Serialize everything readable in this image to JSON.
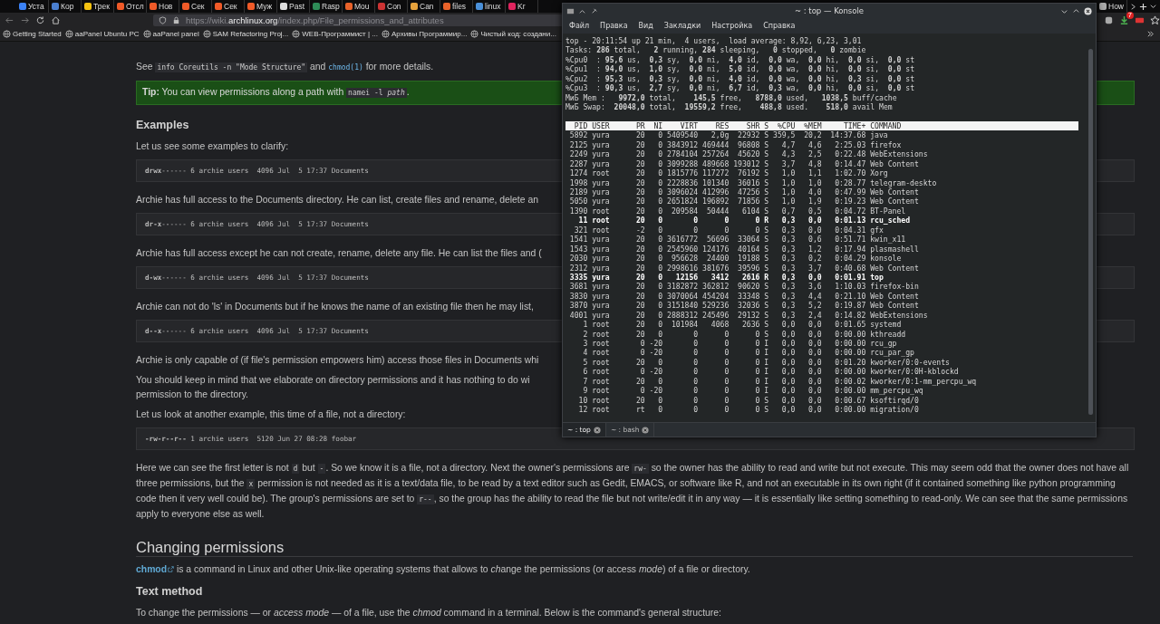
{
  "browser": {
    "tabs": [
      {
        "label": "Уста",
        "color": "#3b82f6",
        "selected": false
      },
      {
        "label": "Кор",
        "color": "#4a7fd0",
        "selected": false
      },
      {
        "label": "Трек",
        "color": "#f5c211",
        "selected": false
      },
      {
        "label": "Отсл",
        "color": "#f05a28",
        "selected": false
      },
      {
        "label": "Нов",
        "color": "#f05a28",
        "selected": false
      },
      {
        "label": "Сек",
        "color": "#f05a28",
        "selected": false
      },
      {
        "label": "Сек",
        "color": "#f05a28",
        "selected": false
      },
      {
        "label": "Муж",
        "color": "#f05a28",
        "selected": false
      },
      {
        "label": "Past",
        "color": "#dddddd",
        "selected": false
      },
      {
        "label": "Rasp",
        "color": "#2e8b57",
        "selected": false
      },
      {
        "label": "Mou",
        "color": "#e8622a",
        "selected": false
      },
      {
        "label": "Con",
        "color": "#cc3333",
        "selected": false
      },
      {
        "label": "Can",
        "color": "#e6a23c",
        "selected": false
      },
      {
        "label": "files",
        "color": "#e8622a",
        "selected": false
      },
      {
        "label": "linux",
        "color": "#4a90d9",
        "selected": false
      },
      {
        "label": "Kr",
        "color": "#e0245e",
        "selected": false
      }
    ],
    "right_tabs": [
      {
        "label": "How",
        "color": "#aaaaaa",
        "selected": false
      }
    ],
    "url": {
      "prefix": "https://wiki.",
      "domain": "archlinux.org",
      "path": "/index.php/File_permissions_and_attributes"
    },
    "download_badge": "7",
    "bookmarks": [
      "Getting Started",
      "aaPanel Ubuntu PC",
      "aaPanel panel",
      "SAM Refactoring Proj...",
      "WEB-Программист | ...",
      "Архивы Программир...",
      "Чистый код: создани..."
    ]
  },
  "article": {
    "blocks": [
      {
        "kind": "paragraph",
        "parts": [
          {
            "kind": "text",
            "text": "See "
          },
          {
            "kind": "code",
            "text": "info Coreutils -n \"Mode Structure\""
          },
          {
            "kind": "text",
            "text": " and "
          },
          {
            "kind": "codelink",
            "text": "chmod(1)"
          },
          {
            "kind": "text",
            "text": " for more details."
          }
        ]
      },
      {
        "kind": "tip",
        "parts": [
          {
            "kind": "text",
            "text": "**Tip:** You can view permissions along a path with "
          },
          {
            "kind": "code",
            "text": "namei -l *path*"
          },
          {
            "kind": "text",
            "text": "."
          }
        ]
      },
      {
        "kind": "heading",
        "text": "Examples"
      },
      {
        "kind": "paragraph",
        "parts": [
          {
            "kind": "text",
            "text": "Let us see some examples to clarify:"
          }
        ]
      },
      {
        "kind": "codeblock",
        "text": "**drwx**------ 6 archie users  4096 Jul  5 17:37 Documents"
      },
      {
        "kind": "paragraph",
        "parts": [
          {
            "kind": "text",
            "text": "Archie has full access to the Documents directory. He can list, create files and rename, delete an"
          }
        ]
      },
      {
        "kind": "codeblock",
        "text": "**dr-x**------ 6 archie users  4096 Jul  5 17:37 Documents"
      },
      {
        "kind": "paragraph",
        "parts": [
          {
            "kind": "text",
            "text": "Archie has full access except he can not create, rename, delete any file. He can list the files and ("
          }
        ]
      },
      {
        "kind": "codeblock",
        "text": "**d-wx**------ 6 archie users  4096 Jul  5 17:37 Documents"
      },
      {
        "kind": "paragraph",
        "parts": [
          {
            "kind": "text",
            "text": "Archie can not do 'ls' in Documents but if he knows the name of an existing file then he may list,"
          }
        ]
      },
      {
        "kind": "codeblock",
        "text": "**d--x**------ 6 archie users  4096 Jul  5 17:37 Documents"
      },
      {
        "kind": "paragraph",
        "parts": [
          {
            "kind": "text",
            "text": "Archie is only capable of (if file's permission empowers him) access those files in Documents whi"
          }
        ]
      },
      {
        "kind": "lines",
        "lines": [
          "You should keep in mind that we elaborate on directory permissions and it has nothing to do wi",
          "permission to the directory."
        ]
      },
      {
        "kind": "paragraph",
        "parts": [
          {
            "kind": "text",
            "text": "Let us look at another example, this time of a file, not a directory:"
          }
        ]
      },
      {
        "kind": "codeblock",
        "text": "**-rw-r--r--** 1 archie users  5120 Jun 27 08:28 foobar"
      },
      {
        "kind": "paragraph",
        "parts": [
          {
            "kind": "text",
            "text": "Here we can see the first letter is not "
          },
          {
            "kind": "code",
            "text": "d"
          },
          {
            "kind": "text",
            "text": " but "
          },
          {
            "kind": "code",
            "text": "-"
          },
          {
            "kind": "text",
            "text": ". So we know it is a file, not a directory. Next the owner's permissions are "
          },
          {
            "kind": "code",
            "text": "rw-"
          },
          {
            "kind": "text",
            "text": " so the owner has the ability to read and write but not execute. This may seem odd that the owner does not have all three permissions, but the "
          },
          {
            "kind": "code",
            "text": "x"
          },
          {
            "kind": "text",
            "text": " permission is not needed as it is a text/data file, to be read by a text editor such as Gedit, EMACS, or software like R, and not an executable in its own right (if it contained something like python programming code then it very well could be). The group's permissions are set to "
          },
          {
            "kind": "code",
            "text": "r--"
          },
          {
            "kind": "text",
            "text": ", so the group has the ability to read the file but not write/edit it in any way — it is essentially like setting something to read-only. We can see that the same permissions apply to everyone else as well."
          }
        ]
      },
      {
        "kind": "section",
        "text": "Changing permissions"
      },
      {
        "kind": "paragraph",
        "parts": [
          {
            "kind": "link",
            "text": "chmod"
          },
          {
            "kind": "text",
            "text": " is a command in Linux and other Unix-like operating systems that allows to "
          },
          {
            "kind": "italic",
            "text": "ch"
          },
          {
            "kind": "text",
            "text": "ange the permissions (or access "
          },
          {
            "kind": "italic",
            "text": "mode"
          },
          {
            "kind": "text",
            "text": ") of a file or directory."
          }
        ]
      },
      {
        "kind": "heading",
        "text": "Text method"
      },
      {
        "kind": "paragraph",
        "parts": [
          {
            "kind": "text",
            "text": "To change the permissions — or *access mode* — of a file, use the *chmod* command in a terminal. Below is the command's general structure:"
          }
        ]
      }
    ]
  },
  "konsole": {
    "title": "~ : top — Konsole",
    "menu": [
      "Файл",
      "Правка",
      "Вид",
      "Закладки",
      "Настройка",
      "Справка"
    ],
    "summary": [
      "top - 20:11:54 up 21 min,  4 users,  load average: 8,92, 6,23, 3,01",
      "Tasks: **286** total,   **2** running, **284** sleeping,   **0** stopped,   **0** zombie",
      "%Cpu0  : **95,6** us,  **0,3** sy,  **0,0** ni,  **4,0** id,  **0,0** wa,  **0,0** hi,  **0,0** si,  **0,0** st",
      "%Cpu1  : **94,0** us,  **1,0** sy,  **0,0** ni,  **5,0** id,  **0,0** wa,  **0,0** hi,  **0,0** si,  **0,0** st",
      "%Cpu2  : **95,3** us,  **0,3** sy,  **0,0** ni,  **4,0** id,  **0,0** wa,  **0,0** hi,  **0,3** si,  **0,0** st",
      "%Cpu3  : **90,3** us,  **2,7** sy,  **0,0** ni,  **6,7** id,  **0,3** wa,  **0,0** hi,  **0,0** si,  **0,0** st",
      "МиБ Mem :   **9972,0** total,    **145,5** free,   **8788,0** used,   **1038,5** buff/cache",
      "МиБ Swap:  **20048,0** total,  **19559,2** free,    **488,8** used.    **518,0** avail Mem"
    ],
    "columns": [
      "PID",
      "USER",
      "PR",
      "NI",
      "VIRT",
      "RES",
      "SHR",
      "S",
      "%CPU",
      "%MEM",
      "TIME+",
      "COMMAND"
    ],
    "rows": [
      {
        "cells": [
          "5892",
          "yura",
          "20",
          "0",
          "5409540",
          "2,0g",
          "22932",
          "S",
          "359,5",
          "20,2",
          "14:37.68",
          "java"
        ],
        "bold": false
      },
      {
        "cells": [
          "2125",
          "yura",
          "20",
          "0",
          "3843912",
          "469444",
          "96808",
          "S",
          "4,7",
          "4,6",
          "2:25.03",
          "firefox"
        ],
        "bold": false
      },
      {
        "cells": [
          "2249",
          "yura",
          "20",
          "0",
          "2784104",
          "257264",
          "45620",
          "S",
          "4,3",
          "2,5",
          "0:22.48",
          "WebExtensions"
        ],
        "bold": false
      },
      {
        "cells": [
          "2287",
          "yura",
          "20",
          "0",
          "3099288",
          "489668",
          "193012",
          "S",
          "3,7",
          "4,8",
          "0:14.47",
          "Web Content"
        ],
        "bold": false
      },
      {
        "cells": [
          "1274",
          "root",
          "20",
          "0",
          "1815776",
          "117272",
          "76192",
          "S",
          "1,0",
          "1,1",
          "1:02.70",
          "Xorg"
        ],
        "bold": false
      },
      {
        "cells": [
          "1998",
          "yura",
          "20",
          "0",
          "2228836",
          "101340",
          "36016",
          "S",
          "1,0",
          "1,0",
          "0:28.77",
          "telegram-deskto"
        ],
        "bold": false
      },
      {
        "cells": [
          "2189",
          "yura",
          "20",
          "0",
          "3096024",
          "412996",
          "47256",
          "S",
          "1,0",
          "4,0",
          "0:47.99",
          "Web Content"
        ],
        "bold": false
      },
      {
        "cells": [
          "5050",
          "yura",
          "20",
          "0",
          "2651824",
          "196892",
          "71856",
          "S",
          "1,0",
          "1,9",
          "0:19.23",
          "Web Content"
        ],
        "bold": false
      },
      {
        "cells": [
          "1390",
          "root",
          "20",
          "0",
          "209584",
          "50444",
          "6104",
          "S",
          "0,7",
          "0,5",
          "0:04.72",
          "BT-Panel"
        ],
        "bold": false
      },
      {
        "cells": [
          "11",
          "root",
          "20",
          "0",
          "0",
          "0",
          "0",
          "R",
          "0,3",
          "0,0",
          "0:01.13",
          "rcu_sched"
        ],
        "bold": true
      },
      {
        "cells": [
          "321",
          "root",
          "-2",
          "0",
          "0",
          "0",
          "0",
          "S",
          "0,3",
          "0,0",
          "0:04.31",
          "gfx"
        ],
        "bold": false
      },
      {
        "cells": [
          "1541",
          "yura",
          "20",
          "0",
          "3616772",
          "56696",
          "33064",
          "S",
          "0,3",
          "0,6",
          "0:51.71",
          "kwin_x11"
        ],
        "bold": false
      },
      {
        "cells": [
          "1543",
          "yura",
          "20",
          "0",
          "2545960",
          "124176",
          "40164",
          "S",
          "0,3",
          "1,2",
          "0:17.94",
          "plasmashell"
        ],
        "bold": false
      },
      {
        "cells": [
          "2030",
          "yura",
          "20",
          "0",
          "956628",
          "24400",
          "19188",
          "S",
          "0,3",
          "0,2",
          "0:04.29",
          "konsole"
        ],
        "bold": false
      },
      {
        "cells": [
          "2312",
          "yura",
          "20",
          "0",
          "2998616",
          "381676",
          "39596",
          "S",
          "0,3",
          "3,7",
          "0:40.68",
          "Web Content"
        ],
        "bold": false
      },
      {
        "cells": [
          "3335",
          "yura",
          "20",
          "0",
          "12156",
          "3412",
          "2616",
          "R",
          "0,3",
          "0,0",
          "0:01.91",
          "top"
        ],
        "bold": true
      },
      {
        "cells": [
          "3681",
          "yura",
          "20",
          "0",
          "3182872",
          "362812",
          "90620",
          "S",
          "0,3",
          "3,6",
          "1:10.03",
          "firefox-bin"
        ],
        "bold": false
      },
      {
        "cells": [
          "3830",
          "yura",
          "20",
          "0",
          "3070064",
          "454204",
          "33348",
          "S",
          "0,3",
          "4,4",
          "0:21.10",
          "Web Content"
        ],
        "bold": false
      },
      {
        "cells": [
          "3870",
          "yura",
          "20",
          "0",
          "3151840",
          "529236",
          "32036",
          "S",
          "0,3",
          "5,2",
          "0:19.87",
          "Web Content"
        ],
        "bold": false
      },
      {
        "cells": [
          "4001",
          "yura",
          "20",
          "0",
          "2888312",
          "245496",
          "29132",
          "S",
          "0,3",
          "2,4",
          "0:14.82",
          "WebExtensions"
        ],
        "bold": false
      },
      {
        "cells": [
          "1",
          "root",
          "20",
          "0",
          "101984",
          "4068",
          "2636",
          "S",
          "0,0",
          "0,0",
          "0:01.65",
          "systemd"
        ],
        "bold": false
      },
      {
        "cells": [
          "2",
          "root",
          "20",
          "0",
          "0",
          "0",
          "0",
          "S",
          "0,0",
          "0,0",
          "0:00.00",
          "kthreadd"
        ],
        "bold": false
      },
      {
        "cells": [
          "3",
          "root",
          "0",
          "-20",
          "0",
          "0",
          "0",
          "I",
          "0,0",
          "0,0",
          "0:00.00",
          "rcu_gp"
        ],
        "bold": false
      },
      {
        "cells": [
          "4",
          "root",
          "0",
          "-20",
          "0",
          "0",
          "0",
          "I",
          "0,0",
          "0,0",
          "0:00.00",
          "rcu_par_gp"
        ],
        "bold": false
      },
      {
        "cells": [
          "5",
          "root",
          "20",
          "0",
          "0",
          "0",
          "0",
          "I",
          "0,0",
          "0,0",
          "0:01.20",
          "kworker/0:0-events"
        ],
        "bold": false
      },
      {
        "cells": [
          "6",
          "root",
          "0",
          "-20",
          "0",
          "0",
          "0",
          "I",
          "0,0",
          "0,0",
          "0:00.00",
          "kworker/0:0H-kblockd"
        ],
        "bold": false
      },
      {
        "cells": [
          "7",
          "root",
          "20",
          "0",
          "0",
          "0",
          "0",
          "I",
          "0,0",
          "0,0",
          "0:00.02",
          "kworker/0:1-mm_percpu_wq"
        ],
        "bold": false
      },
      {
        "cells": [
          "9",
          "root",
          "0",
          "-20",
          "0",
          "0",
          "0",
          "I",
          "0,0",
          "0,0",
          "0:00.00",
          "mm_percpu_wq"
        ],
        "bold": false
      },
      {
        "cells": [
          "10",
          "root",
          "20",
          "0",
          "0",
          "0",
          "0",
          "S",
          "0,0",
          "0,0",
          "0:00.67",
          "ksoftirqd/0"
        ],
        "bold": false
      },
      {
        "cells": [
          "12",
          "root",
          "rt",
          "0",
          "0",
          "0",
          "0",
          "S",
          "0,0",
          "0,0",
          "0:00.00",
          "migration/0"
        ],
        "bold": false
      }
    ],
    "tabs": [
      {
        "label": "~ : top",
        "selected": true
      },
      {
        "label": "~ : bash",
        "selected": false
      }
    ]
  }
}
